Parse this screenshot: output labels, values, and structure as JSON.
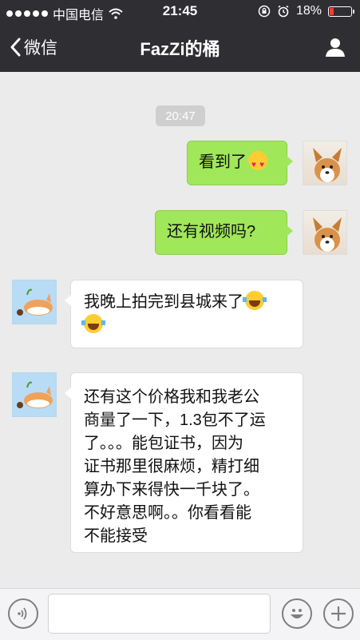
{
  "status_bar": {
    "carrier": "中国电信",
    "time": "21:45",
    "battery_percent": "18%",
    "battery_level": 0.18
  },
  "nav": {
    "back_label": "微信",
    "title": "FazZi的桶"
  },
  "chat": {
    "timestamp": "20:47",
    "messages": [
      {
        "from": "me",
        "text": "看到了",
        "emoji": "heart-eyes-emoji"
      },
      {
        "from": "me",
        "text": "还有视频吗?"
      },
      {
        "from": "them",
        "line1": "我晚上拍完到县城来了",
        "emoji": "tears-of-joy-emoji"
      },
      {
        "from": "them",
        "lines": [
          "还有这个价格我和我老公",
          "商量了一下，1.3包不了运",
          "了。。。能包证书，因为",
          "证书那里很麻烦，精打细",
          "算办下来得快一千块了。",
          "不好意思啊。。你看看能",
          "不能接受"
        ]
      }
    ]
  },
  "colors": {
    "nav_bg": "#2e2e33",
    "chat_bg": "#ebebeb",
    "my_bubble": "#a0e75a",
    "their_bubble": "#ffffff"
  },
  "icons": {
    "voice": "voice-icon",
    "emoji": "emoji-icon",
    "more": "plus-icon",
    "profile": "person-icon",
    "back": "chevron-left-icon"
  }
}
